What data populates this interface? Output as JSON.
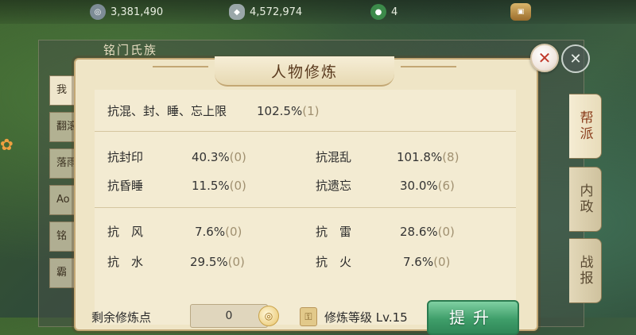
{
  "resources": [
    {
      "icon": "silver-coin-icon",
      "value": "3,381,490"
    },
    {
      "icon": "ingot-icon",
      "value": "4,572,974"
    },
    {
      "icon": "jade-icon",
      "value": "4"
    },
    {
      "icon": "chest-icon",
      "value": ""
    }
  ],
  "background_panel": {
    "title": "铭门氏族",
    "list_items": [
      "我",
      "翻滚",
      "落雨",
      "Ao",
      "铭",
      "霸"
    ]
  },
  "right_tabs": [
    {
      "label": "帮派",
      "active": true
    },
    {
      "label": "内政",
      "active": false
    },
    {
      "label": "战报",
      "active": false
    }
  ],
  "dialog": {
    "title": "人物修炼",
    "summary": {
      "label": "抗混、封、睡、忘上限",
      "value": "102.5%",
      "count": "(1)"
    },
    "group1": [
      {
        "label": "抗封印",
        "value": "40.3%",
        "count": "(0)"
      },
      {
        "label": "抗混乱",
        "value": "101.8%",
        "count": "(8)"
      },
      {
        "label": "抗昏睡",
        "value": "11.5%",
        "count": "(0)"
      },
      {
        "label": "抗遗忘",
        "value": "30.0%",
        "count": "(6)"
      }
    ],
    "group2": [
      {
        "label": "抗　风",
        "value": "7.6%",
        "count": "(0)"
      },
      {
        "label": "抗　雷",
        "value": "28.6%",
        "count": "(0)"
      },
      {
        "label": "抗　水",
        "value": "29.5%",
        "count": "(0)"
      },
      {
        "label": "抗　火",
        "value": "7.6%",
        "count": "(0)"
      }
    ],
    "remaining_label": "剩余修炼点",
    "remaining_value": "0",
    "level_text": "修炼等级 Lv.15",
    "upgrade_label": "提升"
  }
}
